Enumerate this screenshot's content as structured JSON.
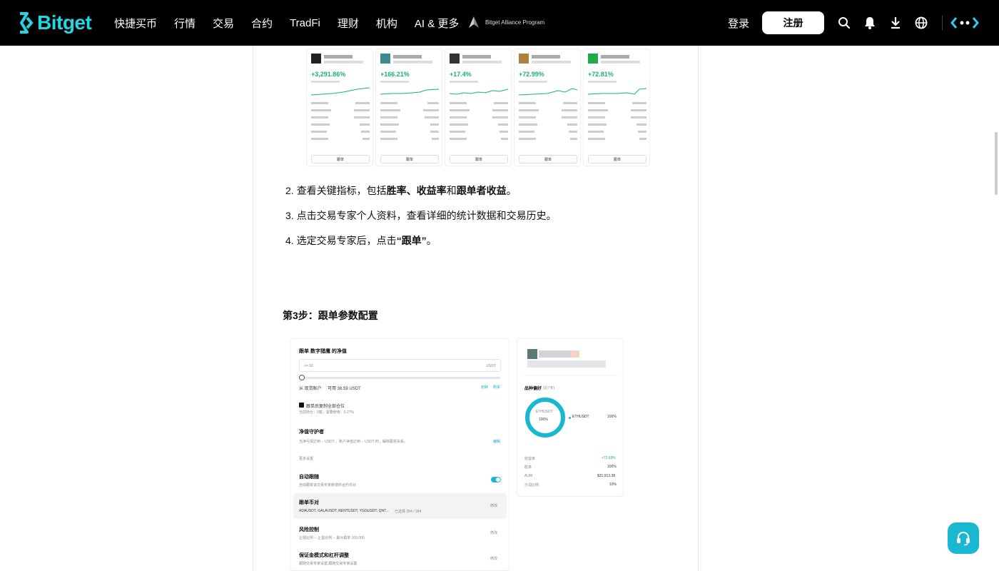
{
  "nav": {
    "logo_text": "Bitget",
    "menu": [
      "快捷买币",
      "行情",
      "交易",
      "合约",
      "TradFi",
      "理财",
      "机构",
      "AI & 更多"
    ],
    "alliance_text": "Bitget Alliance Program",
    "login_label": "登录",
    "register_label": "注册",
    "icons": [
      "search-icon",
      "bell-icon",
      "download-icon",
      "globe-icon",
      "more-icon"
    ]
  },
  "cards": [
    {
      "pct": "+3,291.86%",
      "button": "跟单",
      "avatar_color": "#222"
    },
    {
      "pct": "+166.21%",
      "button": "跟单",
      "avatar_color": "#3b8a8f"
    },
    {
      "pct": "+17.4%",
      "button": "跟单",
      "avatar_color": "#333"
    },
    {
      "pct": "+72.99%",
      "button": "跟单",
      "avatar_color": "#b08040"
    },
    {
      "pct": "+72.81%",
      "button": "跟单",
      "avatar_color": "#22aa44"
    }
  ],
  "steps": [
    {
      "num": "2.",
      "pre": "查看关键指标，包括",
      "b1": "胜率",
      "mid1": "、",
      "b2": "收益率",
      "mid2": "和",
      "b3": "跟单者收益",
      "post": "。"
    },
    {
      "num": "3.",
      "text": "点击交易专家个人资料，查看详细的统计数据和交易历史。"
    },
    {
      "num": "4.",
      "pre": "选定交易专家后，点击",
      "b1": "“跟单”",
      "post": "。"
    }
  ],
  "section_title": "第3步：跟单参数配置",
  "settings": {
    "title": "跟单 数字猎鹰 的净值",
    "input_placeholder": ">= 50",
    "input_unit": "USDT",
    "account": "从 现货账户",
    "available": "可用 38.59 USDT",
    "transfer": "划转",
    "buy": "购买",
    "copy_positions": "跟单后复制全部仓位",
    "copy_positions_sub": "当前持仓：0笔，需要使用：0.27%",
    "guardian_title": "净值守护者",
    "guardian_desc": "当净亏损达到 -- USDT ，账户净值达到 -- USDT 时，解除跟单关系。",
    "guardian_edit": "编辑",
    "more_settings": "更多设置",
    "auto_follow": "自动跟随",
    "auto_follow_sub": "自动跟单该交易专家新增的合约币对",
    "pairs_title": "跟单币对",
    "pairs_list": "ADAUSDT, GALAUSDT, RENTUSDT, YGGUSDT, QNT...",
    "pairs_count": "已选择 284 / 284",
    "pairs_edit": "修改",
    "risk_title": "风险控制",
    "risk_sub": "止损比例 --   止盈比例 --   最大跟单 100,000",
    "risk_edit": "修改",
    "margin_title": "保证金模式和杠杆调整",
    "margin_sub": "跟随交易专家设置,跟随交易专家设置",
    "margin_edit": "修改"
  },
  "preference": {
    "title": "品种偏好",
    "title_sub": "(近7天)",
    "donut_label": "ETHUSDT",
    "donut_pct": "100%",
    "legend_name": "ETHUSDT",
    "legend_pct": "100%",
    "rows": [
      {
        "k": "收益率",
        "v": "+72.69%"
      },
      {
        "k": "胜率",
        "v": "100%"
      },
      {
        "k": "AUM",
        "v": "$31,913.38"
      },
      {
        "k": "分润比例",
        "v": "10%"
      }
    ],
    "accent": "#1ab8d0"
  }
}
